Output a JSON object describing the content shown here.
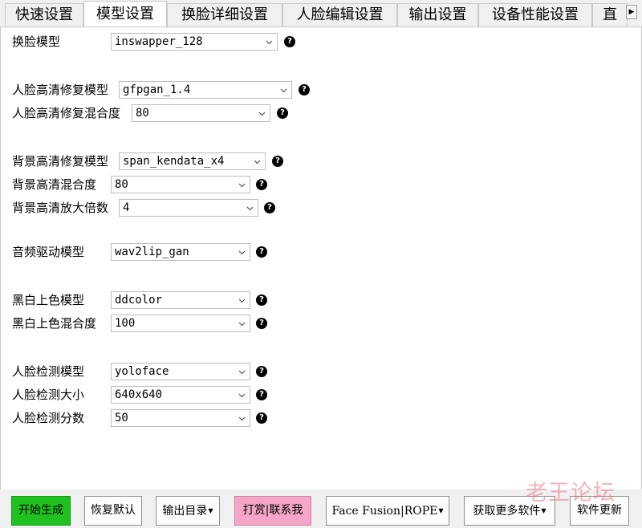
{
  "tabs": [
    {
      "label": "快速设置",
      "active": false
    },
    {
      "label": "模型设置",
      "active": true
    },
    {
      "label": "换脸详细设置",
      "active": false
    },
    {
      "label": "人脸编辑设置",
      "active": false
    },
    {
      "label": "输出设置",
      "active": false
    },
    {
      "label": "设备性能设置",
      "active": false
    },
    {
      "label": "直",
      "active": false
    }
  ],
  "tab_scroll_glyph": "▶",
  "help_glyph": "?",
  "settings": {
    "face_swap_model": {
      "label": "换脸模型",
      "value": "inswapper_128"
    },
    "face_enhancer_model": {
      "label": "人脸高清修复模型",
      "value": "gfpgan_1.4"
    },
    "face_enhancer_blend": {
      "label": "人脸高清修复混合度",
      "value": "80"
    },
    "frame_enhancer_model": {
      "label": "背景高清修复模型",
      "value": "span_kendata_x4"
    },
    "frame_enhancer_blend": {
      "label": "背景高清混合度",
      "value": "80"
    },
    "frame_enhancer_scale": {
      "label": "背景高清放大倍数",
      "value": "4"
    },
    "lip_sync_model": {
      "label": "音频驱动模型",
      "value": "wav2lip_gan"
    },
    "colorizer_model": {
      "label": "黑白上色模型",
      "value": "ddcolor"
    },
    "colorizer_blend": {
      "label": "黑白上色混合度",
      "value": "100"
    },
    "face_detector_model": {
      "label": "人脸检测模型",
      "value": "yoloface"
    },
    "face_detector_size": {
      "label": "人脸检测大小",
      "value": "640x640"
    },
    "face_detector_score": {
      "label": "人脸检测分数",
      "value": "50"
    }
  },
  "buttons": {
    "start": {
      "label": "开始生成"
    },
    "reset": {
      "label": "恢复默认"
    },
    "output_dir": {
      "label": "输出目录"
    },
    "tip_contact": {
      "label": "打赏|联系我"
    },
    "face_fusion_rope": {
      "label": "Face Fusion|ROPE"
    },
    "more_software": {
      "label": "获取更多软件"
    },
    "update": {
      "label": "软件更新"
    }
  },
  "watermark": "老王论坛",
  "colors": {
    "start_button": "#1fc01f",
    "tip_button": "#f5a6c8",
    "panel_background": "#ffffff",
    "window_background": "#f0f0f0"
  }
}
